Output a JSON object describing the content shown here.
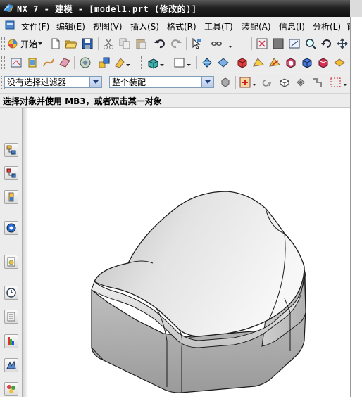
{
  "window": {
    "title": "NX 7 - 建模 - [model1.prt (修改的)]",
    "app_icon": "nx-logo-icon"
  },
  "menubar": {
    "items": [
      {
        "label": "文件(F)"
      },
      {
        "label": "编辑(E)"
      },
      {
        "label": "视图(V)"
      },
      {
        "label": "插入(S)"
      },
      {
        "label": "格式(R)"
      },
      {
        "label": "工具(T)"
      },
      {
        "label": "装配(A)"
      },
      {
        "label": "信息(I)"
      },
      {
        "label": "分析(L)"
      },
      {
        "label": "首"
      }
    ]
  },
  "standard_toolbar": {
    "start_label": "开始",
    "icons": [
      "new-file-icon",
      "open-folder-icon",
      "save-icon",
      "cut-icon",
      "copy-icon",
      "paste-icon",
      "undo-icon",
      "redo-icon",
      "select-icon",
      "touch-mode-icon",
      "view-fit-icon",
      "shaded-view-icon",
      "zoom-icon",
      "rotate-icon",
      "pan-icon",
      "refresh-icon"
    ]
  },
  "selection_toolbar": {
    "type_filter": {
      "value": "没有选择过滤器"
    },
    "scope_filter": {
      "value": "整个装配"
    }
  },
  "cue_line": {
    "text": "选择对象并使用 MB3，或者双击某一对象"
  },
  "resource_bar": {
    "icons": [
      "assembly-navigator-icon",
      "constraint-navigator-icon",
      "part-navigator-icon",
      "reuse-library-icon",
      "web-browser-icon",
      "history-icon",
      "system-materials-icon",
      "process-studio-icon",
      "roles-icon",
      "palette-icon"
    ]
  },
  "colors": {
    "title_bar": "#1a1a1a",
    "model_fill": "#d9d9d9",
    "model_edge": "#1a1a1a",
    "viewport_bg": "#ffffff"
  }
}
